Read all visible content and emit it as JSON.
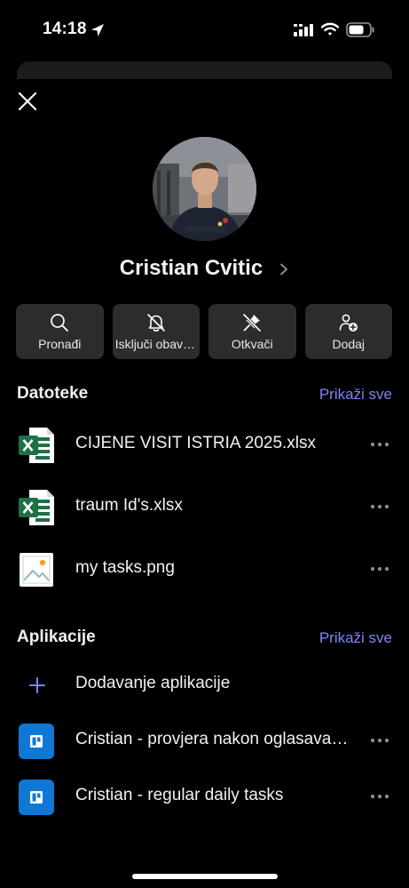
{
  "status_bar": {
    "time": "14:18"
  },
  "profile": {
    "name": "Cristian Cvitic"
  },
  "actions": [
    {
      "label": "Pronađi",
      "icon": "search-icon"
    },
    {
      "label": "Isključi obavijesti",
      "icon": "bell-off-icon"
    },
    {
      "label": "Otkvači",
      "icon": "unpin-icon"
    },
    {
      "label": "Dodaj",
      "icon": "add-person-icon"
    }
  ],
  "files": {
    "title": "Datoteke",
    "show_all": "Prikaži sve",
    "items": [
      {
        "name": "CIJENE VISIT ISTRIA 2025.xlsx",
        "icon": "excel-file-icon"
      },
      {
        "name": "traum Id's.xlsx",
        "icon": "excel-file-icon"
      },
      {
        "name": "my tasks.png",
        "icon": "image-file-icon"
      }
    ]
  },
  "apps": {
    "title": "Aplikacije",
    "show_all": "Prikaži sve",
    "add_label": "Dodavanje aplikacije",
    "items": [
      {
        "name": "Cristian - provjera nakon oglasavanja",
        "icon": "planner-app-icon"
      },
      {
        "name": "Cristian - regular daily tasks",
        "icon": "planner-app-icon"
      }
    ]
  },
  "colors": {
    "background": "#000000",
    "card": "#2c2c2e",
    "accent_link": "#7f86f2",
    "excel_green": "#1d7145",
    "app_blue": "#0f78d4"
  }
}
